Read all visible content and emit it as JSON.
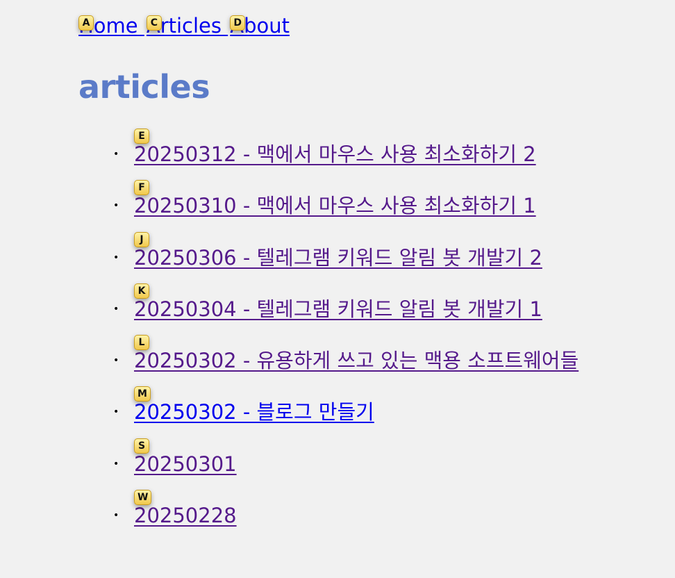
{
  "nav": [
    {
      "label": "Home",
      "hint": "A"
    },
    {
      "label": "Articles",
      "hint": "C"
    },
    {
      "label": "About",
      "hint": "D"
    }
  ],
  "page_title": "articles",
  "articles": [
    {
      "label": "20250312 - 맥에서 마우스 사용 최소화하기 2",
      "hint": "E",
      "visited": true
    },
    {
      "label": "20250310 - 맥에서 마우스 사용 최소화하기 1",
      "hint": "F",
      "visited": true
    },
    {
      "label": "20250306 - 텔레그램 키워드 알림 봇 개발기 2",
      "hint": "J",
      "visited": true
    },
    {
      "label": "20250304 - 텔레그램 키워드 알림 봇 개발기 1",
      "hint": "K",
      "visited": true
    },
    {
      "label": "20250302 - 유용하게 쓰고 있는 맥용 소프트웨어들",
      "hint": "L",
      "visited": true
    },
    {
      "label": "20250302 - 블로그 만들기",
      "hint": "M",
      "visited": false
    },
    {
      "label": "20250301",
      "hint": "S",
      "visited": true
    },
    {
      "label": "20250228",
      "hint": "W",
      "visited": true
    }
  ],
  "bullet": "•",
  "colors": {
    "background": "#f1f1f1",
    "title": "#5b7bc8",
    "link": "#0000ee",
    "visited_link": "#551a8b",
    "hint_background": "#f1c84c"
  }
}
